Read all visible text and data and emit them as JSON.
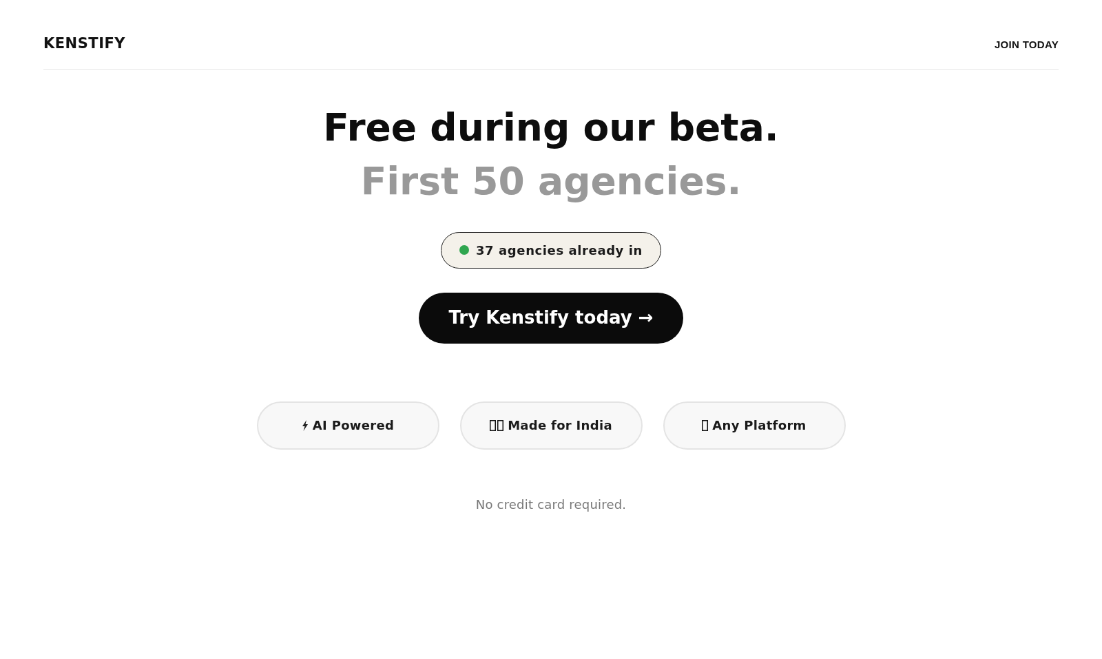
{
  "header": {
    "logo": "KENSTIFY",
    "nav_link": "JOIN TODAY"
  },
  "hero": {
    "title": "Free during our beta.",
    "subtitle": "First 50 agencies.",
    "badge": {
      "text": "37 agencies already in"
    },
    "cta": "Try Kenstify today →"
  },
  "features": [
    {
      "kind": "bolt",
      "label": "AI Powered"
    },
    {
      "kind": "boxes",
      "label": "Made for India"
    },
    {
      "kind": "box",
      "label": "Any Platform"
    }
  ],
  "note": "No credit card required."
}
